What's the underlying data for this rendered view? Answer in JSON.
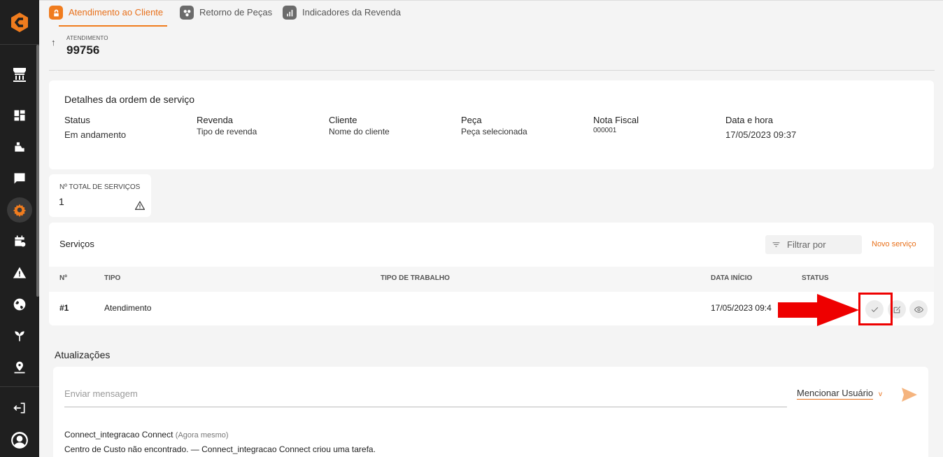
{
  "tabs": [
    {
      "label": "Atendimento ao Cliente",
      "active": true
    },
    {
      "label": "Retorno de Peças",
      "active": false
    },
    {
      "label": "Indicadores da Revenda",
      "active": false
    }
  ],
  "header": {
    "label": "ATENDIMENTO",
    "number": "99756"
  },
  "details": {
    "title": "Detalhes da ordem de serviço",
    "fields": [
      {
        "label": "Status",
        "value": "Em andamento"
      },
      {
        "label": "Revenda",
        "value": "Tipo de revenda"
      },
      {
        "label": "Cliente",
        "value": "Nome do cliente"
      },
      {
        "label": "Peça",
        "value": "Peça selecionada"
      },
      {
        "label": "Nota Fiscal",
        "value": "000001"
      },
      {
        "label": "Data e hora",
        "value": "17/05/2023 09:37"
      }
    ]
  },
  "total": {
    "label": "Nº TOTAL DE SERVIÇOS",
    "value": "1"
  },
  "services": {
    "title": "Serviços",
    "filter_label": "Filtrar por",
    "new_label": "Novo serviço",
    "columns": [
      "Nº",
      "TIPO",
      "TIPO DE TRABALHO",
      "DATA INÍCIO",
      "STATUS"
    ],
    "rows": [
      {
        "num": "#1",
        "tipo": "Atendimento",
        "trabalho": "",
        "data": "17/05/2023 09:4",
        "status": ""
      }
    ]
  },
  "updates": {
    "title": "Atualizações",
    "input_placeholder": "Enviar mensagem",
    "mention_label": "Mencionar Usuário",
    "mention_chevron": "v",
    "log": [
      {
        "author": "Connect_integracao Connect",
        "when": "(Agora mesmo)",
        "text": "Centro de Custo não encontrado. — Connect_integracao Connect criou uma tarefa."
      }
    ]
  },
  "colors": {
    "accent": "#f07c1e",
    "sidebar": "#1f1f1f",
    "annotation": "#ee0000"
  }
}
